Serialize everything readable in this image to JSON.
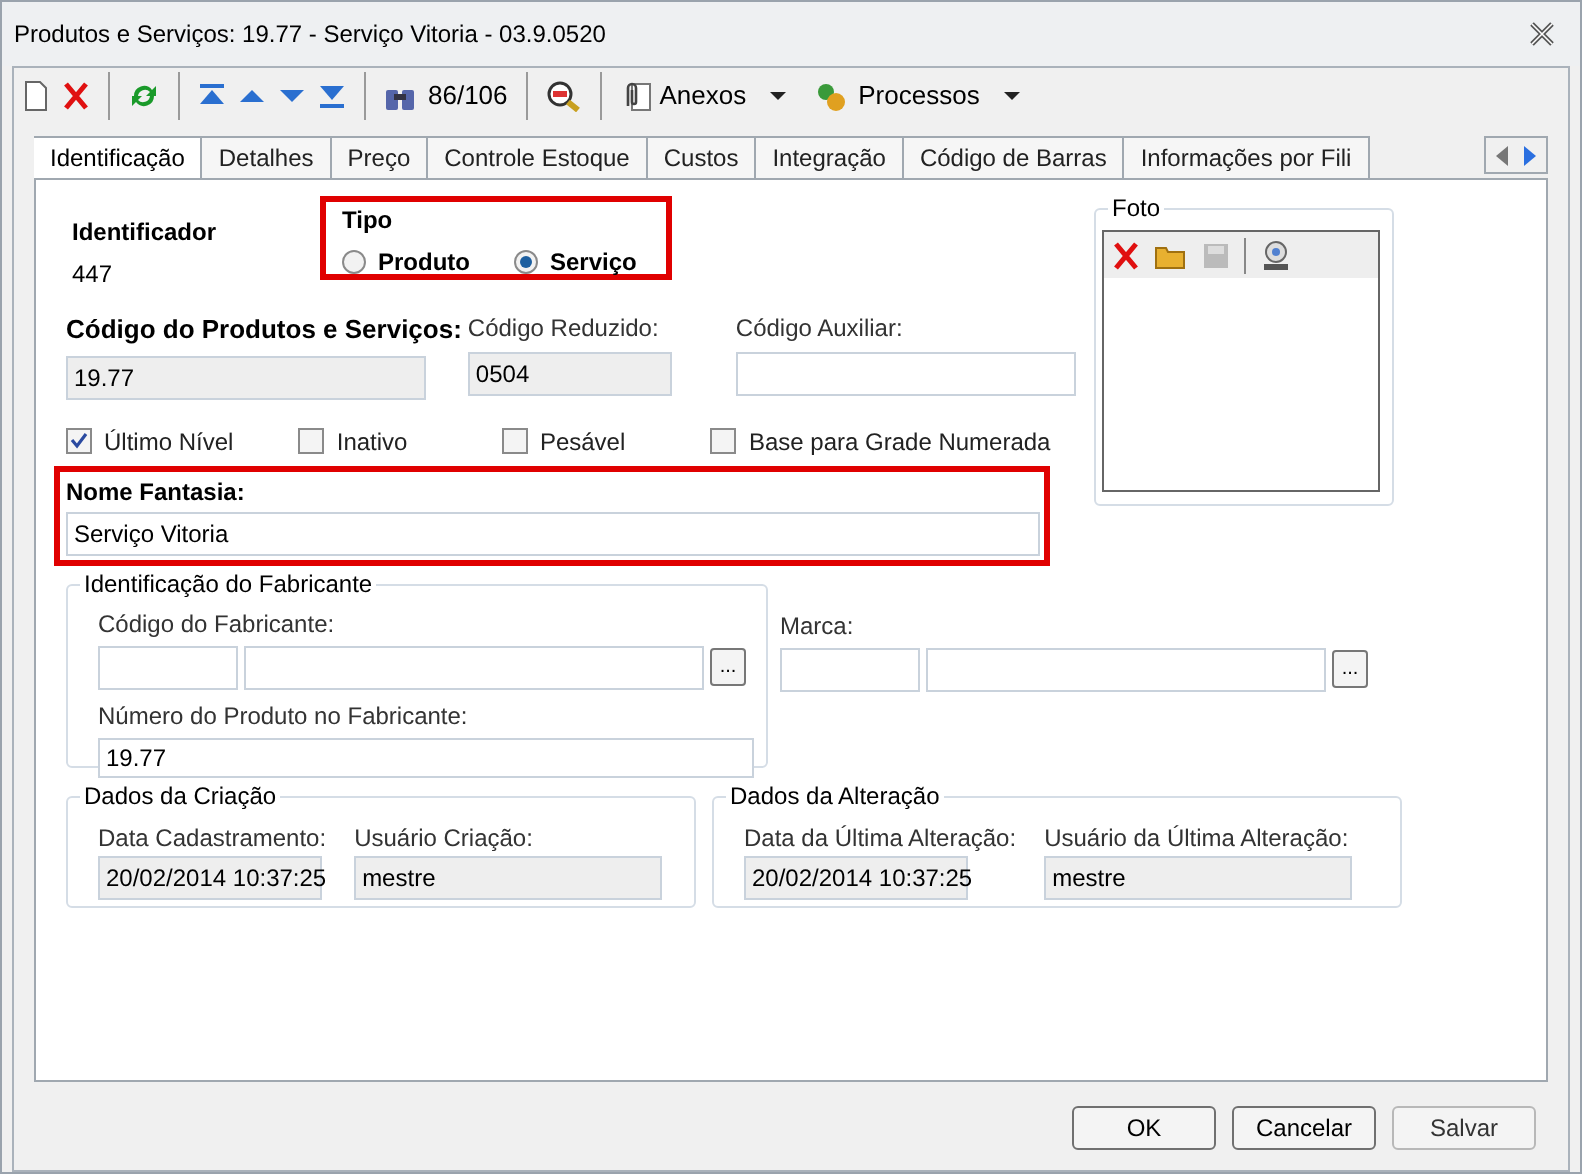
{
  "window": {
    "title": "Produtos e Serviços: 19.77 - Serviço Vitoria - 03.9.0520"
  },
  "toolbar": {
    "counter": "86/106",
    "menus": [
      {
        "label": "Anexos"
      },
      {
        "label": "Processos"
      }
    ]
  },
  "tabs": [
    {
      "label": "Identificação",
      "selected": true
    },
    {
      "label": "Detalhes",
      "selected": false
    },
    {
      "label": "Preço",
      "selected": false
    },
    {
      "label": "Controle Estoque",
      "selected": false
    },
    {
      "label": "Custos",
      "selected": false
    },
    {
      "label": "Integração",
      "selected": false
    },
    {
      "label": "Código de Barras",
      "selected": false
    },
    {
      "label": "Informações por Fili",
      "selected": false
    }
  ],
  "identificador": {
    "label": "Identificador",
    "value": "447"
  },
  "tipo": {
    "title": "Tipo",
    "highlighted": true,
    "options": [
      {
        "label": "Produto",
        "selected": false
      },
      {
        "label": "Serviço",
        "selected": true
      }
    ]
  },
  "codes": [
    {
      "label": "Código do Produtos e Serviços:",
      "value": "19.77",
      "readonly": true,
      "bold": true
    },
    {
      "label": "Código Reduzido:",
      "value": "0504",
      "readonly": true,
      "bold": false
    },
    {
      "label": "Código Auxiliar:",
      "readonly": false,
      "bold": false
    }
  ],
  "checkboxes": [
    {
      "label": "Último Nível",
      "checked": true
    },
    {
      "label": "Inativo",
      "checked": false
    },
    {
      "label": "Pesável",
      "checked": false
    },
    {
      "label": "Base para Grade Numerada",
      "checked": false
    }
  ],
  "nome_fantasia": {
    "label": "Nome Fantasia:",
    "value": "Serviço Vitoria",
    "highlighted": true
  },
  "foto": {
    "title": "Foto"
  },
  "fabricante": {
    "title": "Identificação do Fabricante",
    "codigo_label": "Código do Fabricante:",
    "lookup": "...",
    "numero_label": "Número do Produto no Fabricante:",
    "numero_value": "19.77"
  },
  "marca": {
    "label": "Marca:",
    "lookup": "..."
  },
  "criacao": {
    "title": "Dados da Criação",
    "fields": [
      {
        "label": "Data Cadastramento:",
        "value": "20/02/2014 10:37:25"
      },
      {
        "label": "Usuário Criação:",
        "value": "mestre"
      }
    ]
  },
  "alteracao": {
    "title": "Dados da Alteração",
    "fields": [
      {
        "label": "Data da Última Alteração:",
        "value": "20/02/2014 10:37:25"
      },
      {
        "label": "Usuário da Última Alteração:",
        "value": "mestre"
      }
    ]
  },
  "buttons": [
    {
      "label": "OK"
    },
    {
      "label": "Cancelar"
    },
    {
      "label": "Salvar"
    }
  ]
}
